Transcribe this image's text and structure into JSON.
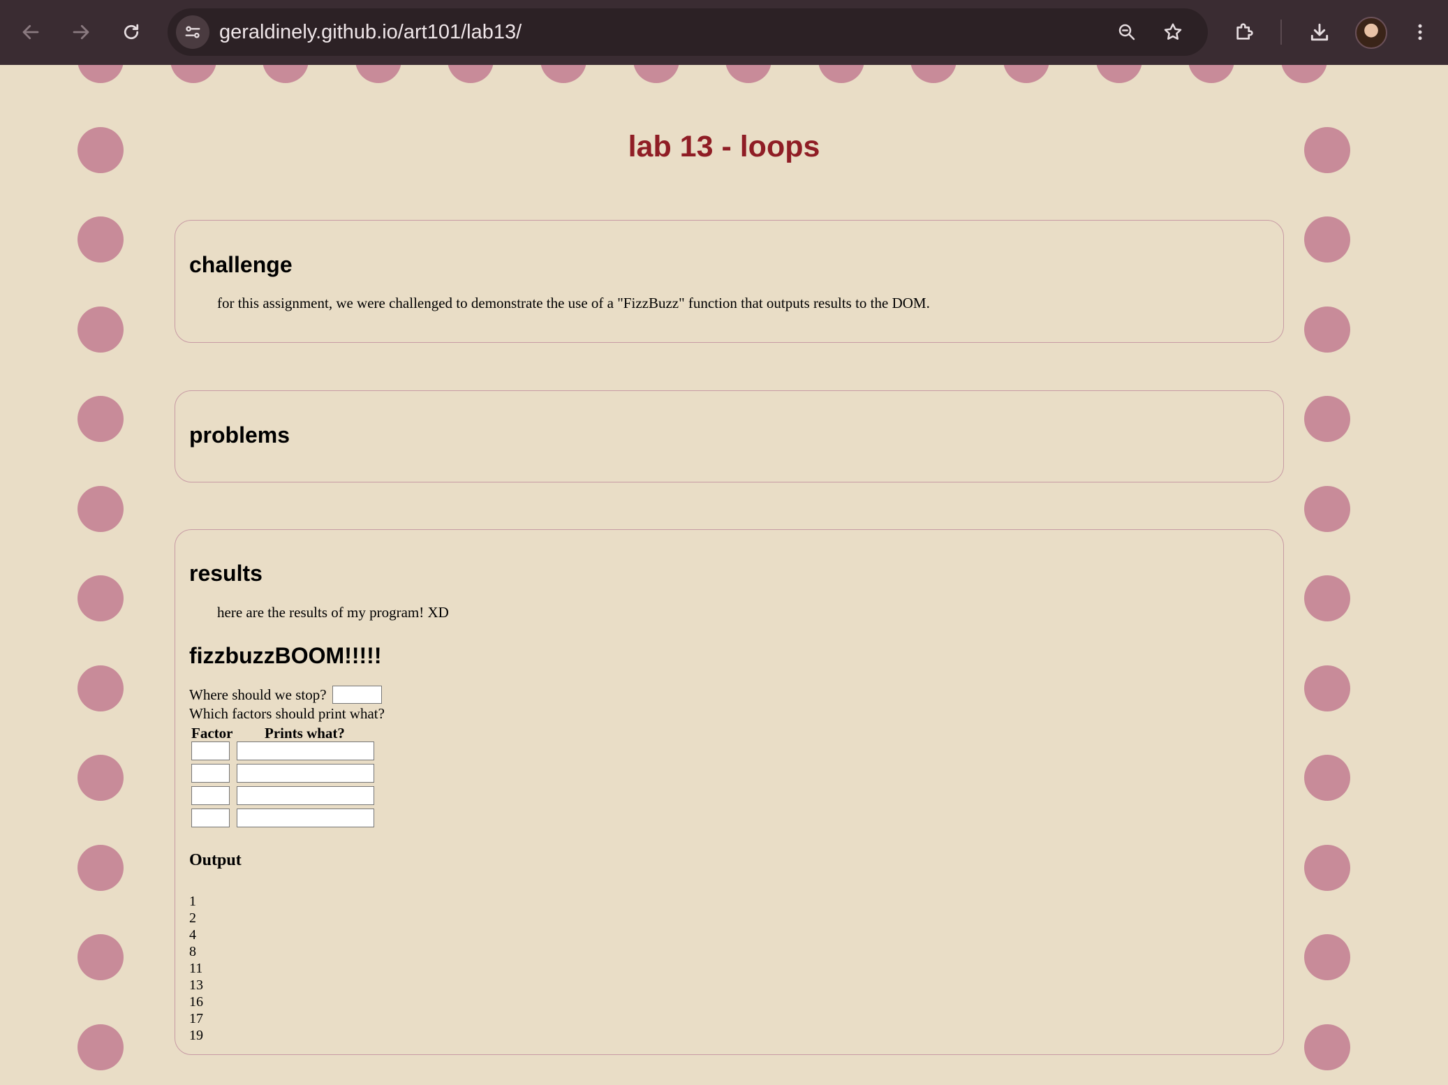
{
  "browser": {
    "url": "geraldinely.github.io/art101/lab13/",
    "icons": {
      "back": "arrow-left-icon",
      "forward": "arrow-right-icon",
      "reload": "reload-icon",
      "site_info": "tune-icon",
      "zoom": "zoom-icon",
      "bookmark": "star-icon",
      "extensions": "puzzle-icon",
      "downloads": "download-icon",
      "profile": "avatar",
      "menu": "kebab-menu-icon"
    }
  },
  "page": {
    "title": "lab 13 - loops",
    "colors": {
      "background": "#e9ddc6",
      "title": "#8f1d25",
      "dots": "#c88b99",
      "card_border": "#c79aa4"
    },
    "challenge": {
      "heading": "challenge",
      "text": "for this assignment, we were challenged to demonstrate the use of a \"FizzBuzz\" function that outputs results to the DOM."
    },
    "problems": {
      "heading": "problems"
    },
    "results": {
      "heading": "results",
      "text": "here are the results of my program! XD",
      "fizzbuzz_title": "fizzbuzzBOOM!!!!!",
      "stop_label": "Where should we stop?",
      "stop_value": "",
      "factors_label": "Which factors should print what?",
      "col_factor": "Factor",
      "col_prints": "Prints what?",
      "rows": [
        {
          "factor": "",
          "prints": ""
        },
        {
          "factor": "",
          "prints": ""
        },
        {
          "factor": "",
          "prints": ""
        },
        {
          "factor": "",
          "prints": ""
        }
      ],
      "output_title": "Output",
      "output": [
        "1",
        "2",
        "4",
        "8",
        "11",
        "13",
        "16",
        "17",
        "19"
      ]
    }
  }
}
